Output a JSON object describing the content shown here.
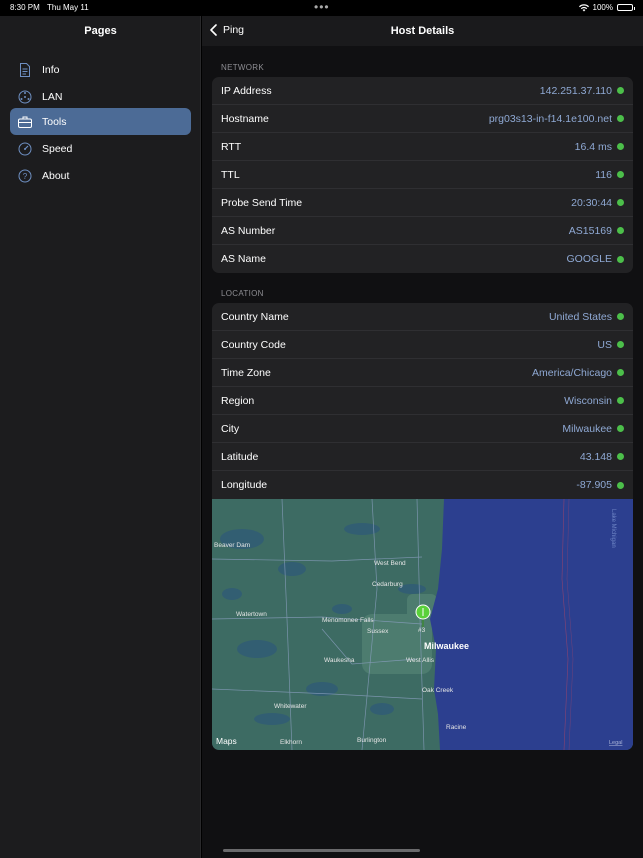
{
  "status_bar": {
    "time": "8:30 PM",
    "date": "Thu May 11",
    "battery": "100%"
  },
  "sidebar": {
    "title": "Pages",
    "items": [
      {
        "label": "Info",
        "icon": "document-icon"
      },
      {
        "label": "LAN",
        "icon": "network-icon"
      },
      {
        "label": "Tools",
        "icon": "toolbox-icon",
        "active": true
      },
      {
        "label": "Speed",
        "icon": "speedometer-icon"
      },
      {
        "label": "About",
        "icon": "question-icon"
      }
    ]
  },
  "navbar": {
    "back_label": "Ping",
    "title": "Host Details"
  },
  "network": {
    "header": "NETWORK",
    "rows": [
      {
        "label": "IP Address",
        "value": "142.251.37.110"
      },
      {
        "label": "Hostname",
        "value": "prg03s13-in-f14.1e100.net"
      },
      {
        "label": "RTT",
        "value": "16.4 ms"
      },
      {
        "label": "TTL",
        "value": "116"
      },
      {
        "label": "Probe Send Time",
        "value": "20:30:44"
      },
      {
        "label": "AS Number",
        "value": "AS15169"
      },
      {
        "label": "AS Name",
        "value": "GOOGLE"
      }
    ]
  },
  "location": {
    "header": "LOCATION",
    "rows": [
      {
        "label": "Country Name",
        "value": "United States"
      },
      {
        "label": "Country Code",
        "value": "US"
      },
      {
        "label": "Time Zone",
        "value": "America/Chicago"
      },
      {
        "label": "Region",
        "value": "Wisconsin"
      },
      {
        "label": "City",
        "value": "Milwaukee"
      },
      {
        "label": "Latitude",
        "value": "43.148"
      },
      {
        "label": "Longitude",
        "value": "-87.905"
      }
    ]
  },
  "map": {
    "attribution": "Maps",
    "legal": "Legal",
    "lake_label": "Lake Michigan",
    "places": [
      "Beaver Dam",
      "West Bend",
      "Cedarburg",
      "Watertown",
      "Menomonee Falls",
      "Sussex",
      "Milwaukee",
      "Waukesha",
      "West Allis",
      "Oak Creek",
      "Whitewater",
      "Racine",
      "Elkhorn",
      "Burlington"
    ],
    "pin_label": "#3",
    "colors": {
      "land": "#3d6b63",
      "lake": "#2c3f8f",
      "pin": "#5ad13a"
    }
  },
  "colors": {
    "accent": "#4c6b96",
    "value_text": "#8fa9d4",
    "status_dot": "#4cbf4a"
  }
}
